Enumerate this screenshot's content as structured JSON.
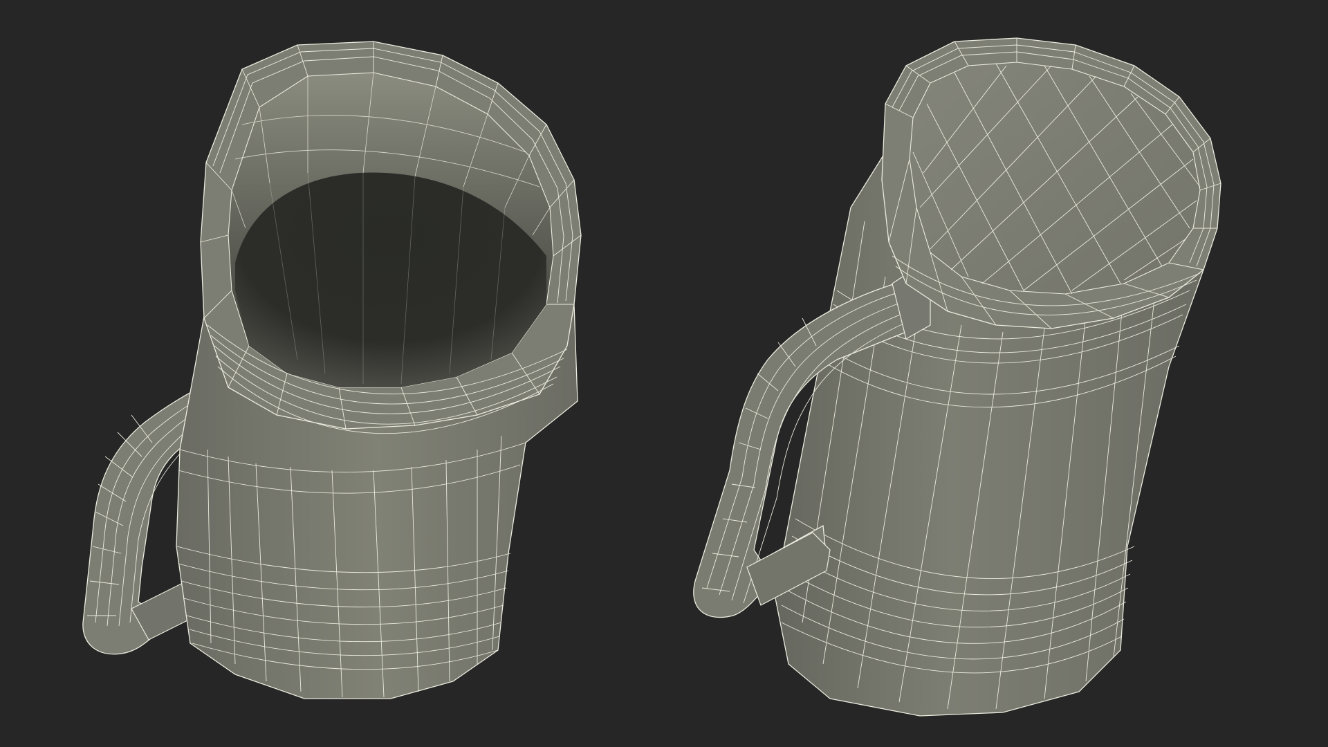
{
  "scene": {
    "background_color": "#262626",
    "surface_color": "#7b7c71",
    "surface_light_color": "#8a8b80",
    "surface_dark_color": "#5f6058",
    "interior_dark_color": "#2b2c28",
    "wire_color": "#ecebdf"
  },
  "objects": [
    {
      "name": "mug-open-view",
      "description_visible": false
    },
    {
      "name": "mug-bottom-view",
      "description_visible": false
    }
  ]
}
